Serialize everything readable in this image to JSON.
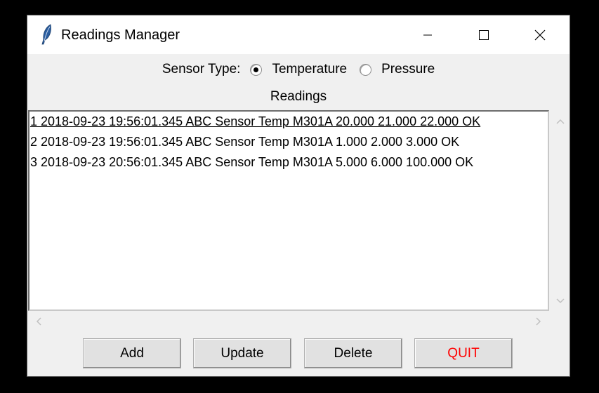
{
  "window": {
    "title": "Readings Manager",
    "icon": "feather-icon"
  },
  "title_controls": {
    "minimize_icon": "minimize-icon",
    "maximize_icon": "maximize-icon",
    "close_icon": "close-icon"
  },
  "sensor_type": {
    "label": "Sensor Type:",
    "options": [
      {
        "label": "Temperature",
        "selected": true
      },
      {
        "label": "Pressure",
        "selected": false
      }
    ]
  },
  "readings": {
    "label": "Readings",
    "items": [
      "1 2018-09-23 19:56:01.345 ABC Sensor Temp M301A 20.000 21.000 22.000 OK",
      "2 2018-09-23 19:56:01.345 ABC Sensor Temp M301A 1.000 2.000 3.000 OK",
      "3 2018-09-23 20:56:01.345 ABC Sensor Temp M301A 5.000 6.000 100.000 OK"
    ],
    "active_index": 0
  },
  "buttons": {
    "add": "Add",
    "update": "Update",
    "delete": "Delete",
    "quit": "QUIT"
  },
  "colors": {
    "quit_text": "#ff0000",
    "icon_blue": "#2a5d9f"
  }
}
